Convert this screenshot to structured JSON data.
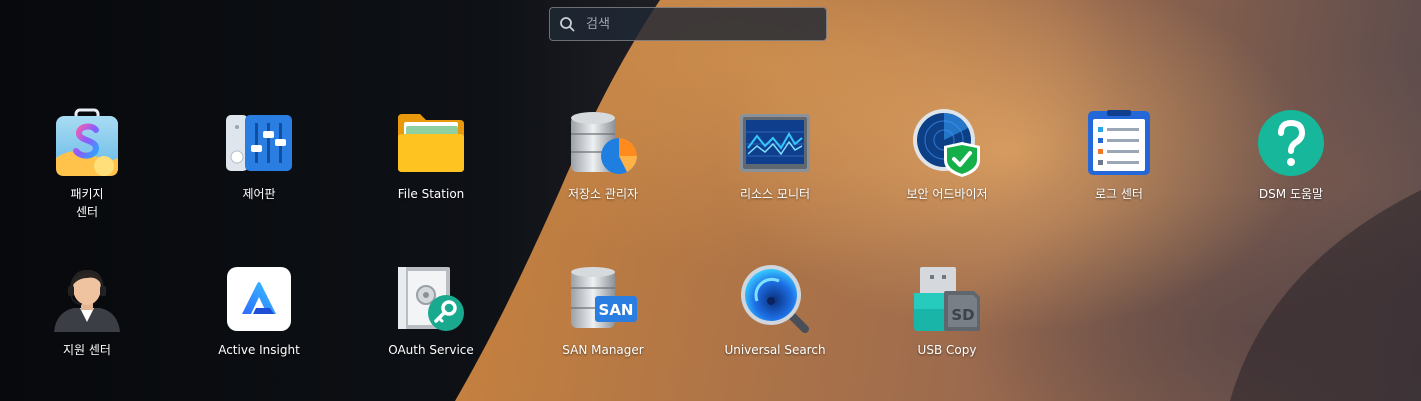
{
  "search": {
    "placeholder": "검색"
  },
  "apps": [
    {
      "label": "패키지\n센터",
      "icon": "package-center-icon"
    },
    {
      "label": "제어판",
      "icon": "control-panel-icon"
    },
    {
      "label": "File Station",
      "icon": "file-station-icon"
    },
    {
      "label": "저장소 관리자",
      "icon": "storage-manager-icon"
    },
    {
      "label": "리소스 모니터",
      "icon": "resource-monitor-icon"
    },
    {
      "label": "보안 어드바이저",
      "icon": "security-advisor-icon"
    },
    {
      "label": "로그 센터",
      "icon": "log-center-icon"
    },
    {
      "label": "DSM 도움말",
      "icon": "dsm-help-icon"
    },
    {
      "label": "지원 센터",
      "icon": "support-center-icon"
    },
    {
      "label": "Active Insight",
      "icon": "active-insight-icon"
    },
    {
      "label": "OAuth Service",
      "icon": "oauth-service-icon"
    },
    {
      "label": "SAN Manager",
      "icon": "san-manager-icon"
    },
    {
      "label": "Universal Search",
      "icon": "universal-search-icon"
    },
    {
      "label": "USB Copy",
      "icon": "usb-copy-icon"
    }
  ],
  "icon_text": {
    "san": "SAN",
    "sd": "SD"
  }
}
